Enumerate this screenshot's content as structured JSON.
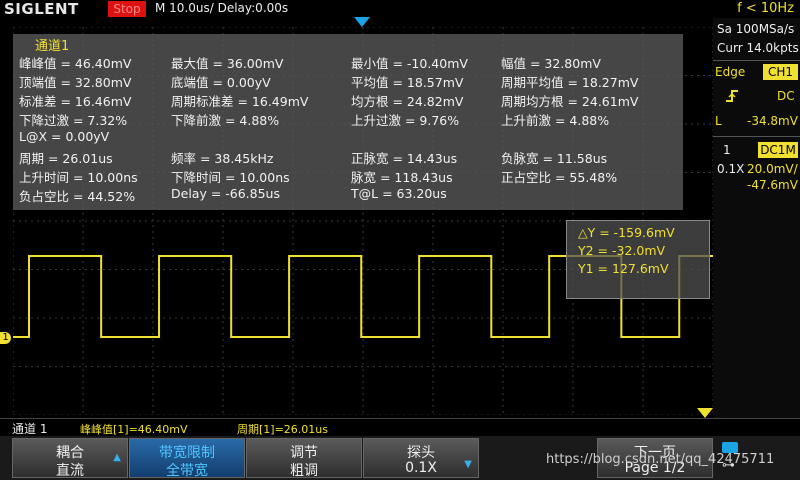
{
  "top": {
    "logo": "SIGLENT",
    "status": "Stop",
    "timebase": "M 10.0us/  Delay:0.00s",
    "trigger_freq": "f < 10Hz"
  },
  "measure": {
    "title": "通道1",
    "rows": [
      [
        "峰峰值 = 46.40mV",
        "最大值 = 36.00mV",
        "最小值 = -10.40mV",
        "幅值 = 32.80mV"
      ],
      [
        "顶端值 = 32.80mV",
        "底端值 = 0.00yV",
        "平均值 = 18.57mV",
        "周期平均值 = 18.27mV"
      ],
      [
        "标准差 = 16.46mV",
        "周期标准差 = 16.49mV",
        "均方根 = 24.82mV",
        "周期均方根 = 24.61mV"
      ],
      [
        "下降过激 = 7.32%",
        "下降前激 = 4.88%",
        "上升过激 = 9.76%",
        "上升前激 = 4.88%"
      ],
      [
        "L@X = 0.00yV",
        "",
        "",
        ""
      ],
      [
        "周期 = 26.01us",
        "频率 = 38.45kHz",
        "正脉宽 = 14.43us",
        "负脉宽 = 11.58us"
      ],
      [
        "上升时间 = 10.00ns",
        "下降时间 = 10.00ns",
        "脉宽 = 118.43us",
        "正占空比 = 55.48%"
      ],
      [
        "负占空比 = 44.52%",
        "Delay = -66.85us",
        "T@L = 63.20us",
        ""
      ]
    ]
  },
  "cursor": {
    "dy": "△Y = -159.6mV",
    "y2": "Y2 = -32.0mV",
    "y1": "Y1 = 127.6mV"
  },
  "right_panel": {
    "sa": "Sa 100MSa/s",
    "curr": "Curr 14.0kpts",
    "edge_label": "Edge",
    "edge_source": "CH1",
    "slope_icon": "rising-edge-icon",
    "coupling": "DC",
    "level_label": "L",
    "level_value": "-34.8mV",
    "ch_num": "1",
    "ch_coupling": "DC1M",
    "probe": "0.1X",
    "volts_div": "20.0mV/",
    "offset": "-47.6mV"
  },
  "statusbar": {
    "channel": "通道 1",
    "m1": "峰峰值[1]=46.40mV",
    "m2": "周期[1]=26.01us"
  },
  "menu": [
    {
      "l1": "耦合",
      "l2": "直流",
      "arrow": "▲",
      "active": false
    },
    {
      "l1": "带宽限制",
      "l2": "全带宽",
      "arrow": "",
      "active": true
    },
    {
      "l1": "调节",
      "l2": "粗调",
      "arrow": "",
      "active": false
    },
    {
      "l1": "探头",
      "l2": "0.1X",
      "arrow": "▼",
      "active": false
    },
    {
      "l1": "下一页",
      "l2": "Page 1/2",
      "arrow": "",
      "active": false
    }
  ],
  "watermark": "https://blog.csdn.net/qq_42475711",
  "colors": {
    "ch1": "#f0e030",
    "accent": "#1aa4e6",
    "stop": "#dd1111"
  },
  "channel_marker": "1"
}
